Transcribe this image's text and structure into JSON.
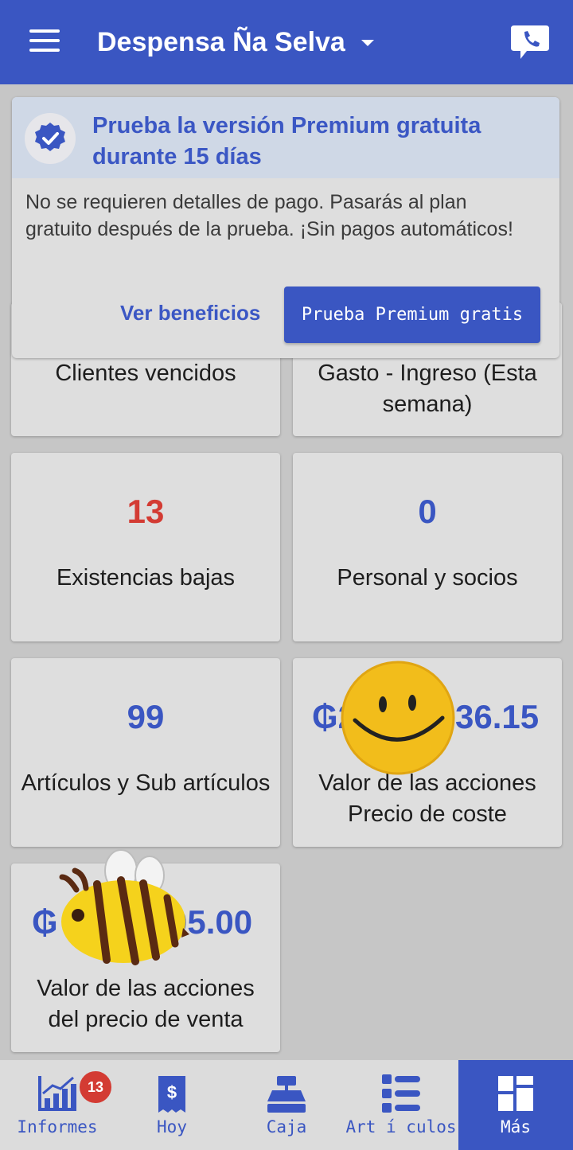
{
  "app_bar": {
    "title": "Despensa Ña Selva",
    "icons": [
      "menu-icon",
      "caret-down-icon",
      "support-chat-icon"
    ]
  },
  "premium_banner": {
    "title": "Prueba la versión Premium gratuita durante 15 días",
    "body": "No se requieren detalles de pago. Pasarás al plan gratuito después de la prueba. ¡Sin pagos automáticos!",
    "benefits_link": "Ver beneficios",
    "trial_button": "Prueba Premium gratis",
    "icon": "verified-badge-icon"
  },
  "tiles": [
    {
      "label": "Clientes vencidos"
    },
    {
      "label": "Gasto - Ingreso (Esta semana)"
    },
    {
      "value": "13",
      "label": "Existencias bajas",
      "value_color": "#d33b33"
    },
    {
      "value": "0",
      "label": "Personal y socios",
      "value_color": "#3a56c2"
    },
    {
      "value": "99",
      "label": "Artículos y Sub artículos",
      "value_color": "#3a56c2"
    },
    {
      "value": "₲2",
      "value_end": "36.15",
      "label": "Valor de las acciones Precio de coste",
      "value_color": "#3a56c2"
    },
    {
      "value": "₲",
      "value_end": "05.00",
      "label": "Valor de las acciones del precio de venta",
      "value_color": "#3a56c2"
    }
  ],
  "bottom_nav": {
    "items": [
      {
        "label": "Informes",
        "icon": "reports-chart-icon",
        "badge": "13"
      },
      {
        "label": "Hoy",
        "icon": "receipt-icon"
      },
      {
        "label": "Caja",
        "icon": "cash-register-icon"
      },
      {
        "label": "Art í culos",
        "icon": "item-list-icon"
      },
      {
        "label": "Más",
        "icon": "grid-more-icon",
        "active": true
      }
    ]
  },
  "colors": {
    "primary": "#3a56c2",
    "alert": "#d33b33",
    "background": "#c6c6c6",
    "card": "#dedede"
  }
}
